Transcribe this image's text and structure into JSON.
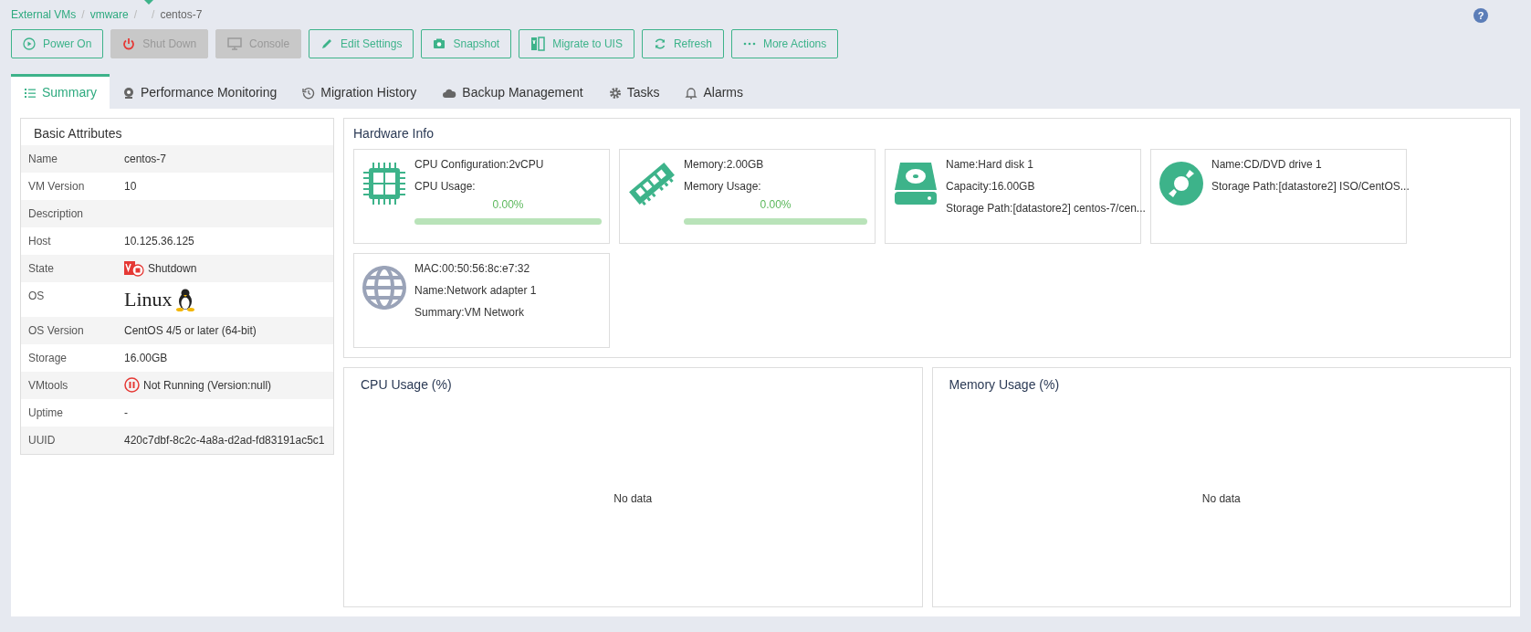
{
  "breadcrumb": [
    {
      "kind": "link",
      "text": "External VMs",
      "separator": "/"
    },
    {
      "kind": "link",
      "text": "vmware",
      "separator": "/"
    },
    {
      "kind": "blank",
      "separator": "/"
    },
    {
      "kind": "current",
      "text": "centos-7"
    }
  ],
  "help": {
    "label": "?"
  },
  "toolbar": [
    {
      "label": "Power On",
      "disabled": false
    },
    {
      "label": "Shut Down",
      "disabled": true
    },
    {
      "label": "Console",
      "disabled": true
    },
    {
      "label": "Edit Settings",
      "disabled": false
    },
    {
      "label": "Snapshot",
      "disabled": false
    },
    {
      "label": "Migrate to UIS",
      "disabled": false
    },
    {
      "label": "Refresh",
      "disabled": false
    },
    {
      "label": "More Actions",
      "disabled": false
    }
  ],
  "tabs": [
    {
      "label": "Summary",
      "selected": true
    },
    {
      "label": "Performance Monitoring",
      "selected": false
    },
    {
      "label": "Migration History",
      "selected": false
    },
    {
      "label": "Backup Management",
      "selected": false
    },
    {
      "label": "Tasks",
      "selected": false
    },
    {
      "label": "Alarms",
      "selected": false
    }
  ],
  "basic_attributes": {
    "title": "Basic Attributes",
    "rows": [
      {
        "label": "Name",
        "kind": "text",
        "value": "centos-7"
      },
      {
        "label": "VM Version",
        "kind": "text",
        "value": "10"
      },
      {
        "label": "Description",
        "kind": "empty"
      },
      {
        "label": "Host",
        "kind": "text",
        "value": "10.125.36.125"
      },
      {
        "label": "State",
        "kind": "state",
        "value": "Shutdown"
      },
      {
        "label": "OS",
        "kind": "os-logo",
        "value": "Linux"
      },
      {
        "label": "OS Version",
        "kind": "text",
        "value": "CentOS 4/5 or later (64-bit)"
      },
      {
        "label": "Storage",
        "kind": "text",
        "value": "16.00GB"
      },
      {
        "label": "VMtools",
        "kind": "paused",
        "value": "Not Running (Version:null)"
      },
      {
        "label": "Uptime",
        "kind": "text",
        "value": "-"
      },
      {
        "label": "UUID",
        "kind": "text",
        "value": "420c7dbf-8c2c-4a8a-d2ad-fd83191ac5c1"
      }
    ]
  },
  "hardware_info": {
    "title": "Hardware Info",
    "devices": [
      {
        "kind": "cpu",
        "lines": [
          "CPU Configuration:2vCPU",
          "CPU Usage:"
        ],
        "usage": {
          "reading": "0.00%",
          "level": 0
        }
      },
      {
        "kind": "memory",
        "lines": [
          "Memory:2.00GB",
          "Memory Usage:"
        ],
        "usage": {
          "reading": "0.00%",
          "level": 0
        }
      },
      {
        "kind": "disk",
        "lines": [
          "Name:Hard disk 1",
          "Capacity:16.00GB",
          "Storage Path:[datastore2] centos-7/cen..."
        ]
      },
      {
        "kind": "cdrom",
        "lines": [
          "Name:CD/DVD drive 1",
          "Storage Path:[datastore2] ISO/CentOS..."
        ]
      },
      {
        "kind": "network",
        "lines": [
          "MAC:00:50:56:8c:e7:32",
          "Name:Network adapter 1",
          "Summary:VM Network"
        ]
      }
    ]
  },
  "charts": [
    {
      "title": "CPU Usage (%)",
      "empty_text": "No data"
    },
    {
      "title": "Memory Usage (%)",
      "empty_text": "No data"
    }
  ]
}
